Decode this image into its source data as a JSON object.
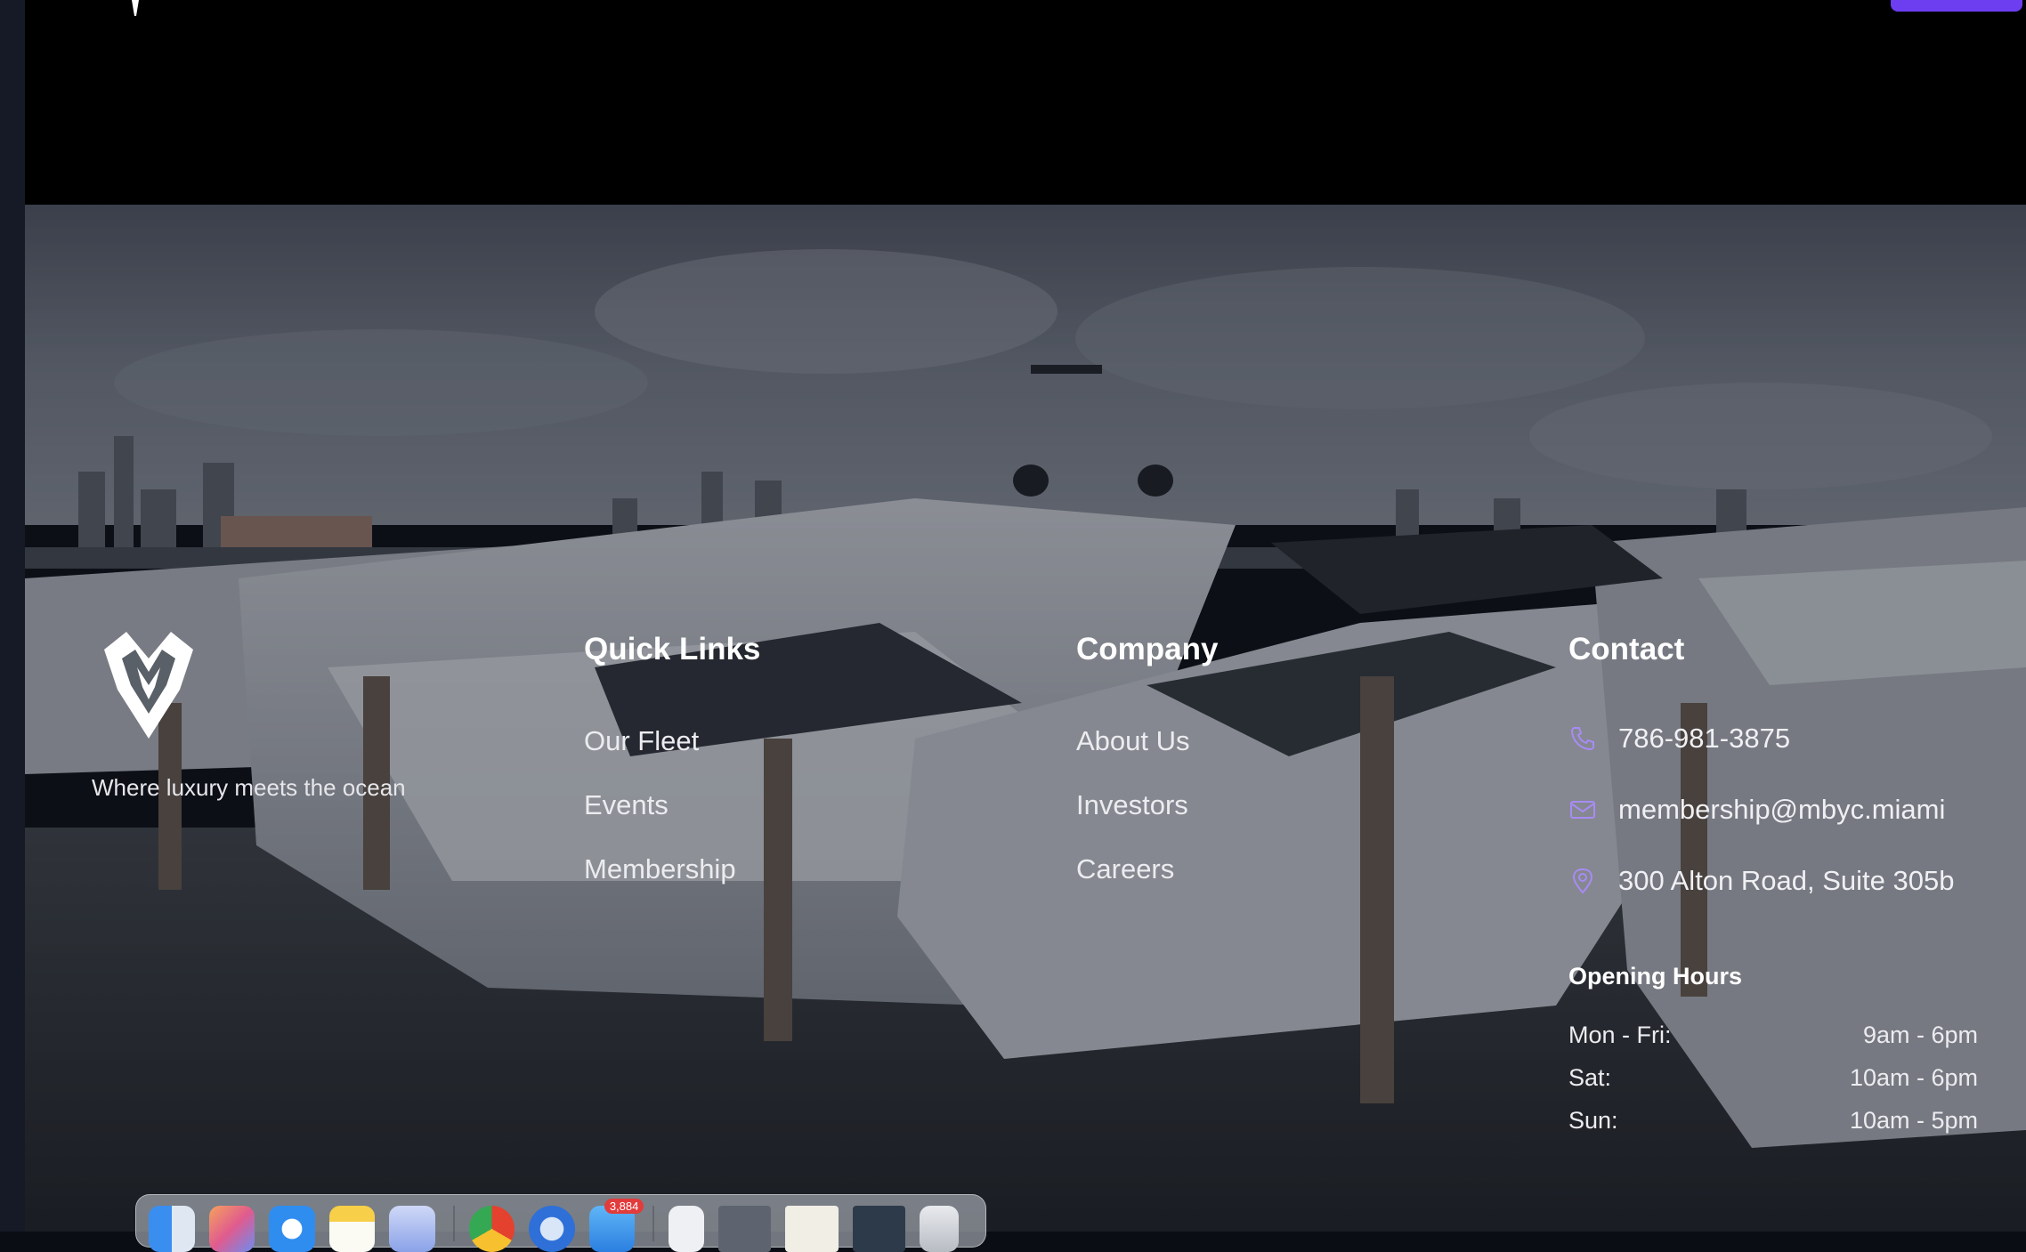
{
  "brand": {
    "name": "MBYC",
    "tagline": "Where luxury meets the ocean"
  },
  "quick_links": {
    "title": "Quick Links",
    "items": [
      "Our Fleet",
      "Events",
      "Membership"
    ]
  },
  "company": {
    "title": "Company",
    "items": [
      "About Us",
      "Investors",
      "Careers"
    ]
  },
  "contact": {
    "title": "Contact",
    "phone": "786-981-3875",
    "email": "membership@mbyc.miami",
    "address": "300 Alton Road, Suite 305b"
  },
  "hours": {
    "title": "Opening Hours",
    "rows": [
      {
        "day": "Mon - Fri:",
        "time": "9am - 6pm"
      },
      {
        "day": "Sat:",
        "time": "10am - 6pm"
      },
      {
        "day": "Sun:",
        "time": "10am - 5pm"
      }
    ]
  },
  "dock": {
    "mail_badge": "3,884",
    "apps": [
      "finder-icon",
      "launchpad-icon",
      "safari-icon",
      "notes-icon",
      "preview-icon",
      "chrome-icon",
      "proxyman-icon",
      "mail-icon",
      "document-icon",
      "screenshot-icon",
      "screenshot-icon",
      "screenshot-icon",
      "trash-icon"
    ]
  },
  "colors": {
    "accent": "#6d3df0",
    "icon_accent": "#a88bf5",
    "topbar": "#000000"
  }
}
